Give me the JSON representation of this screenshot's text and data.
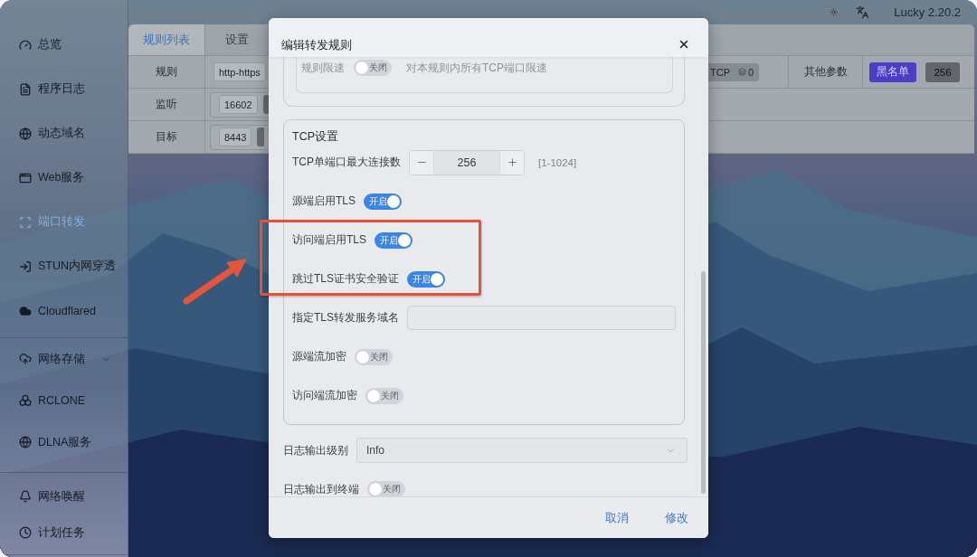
{
  "top_bar": {
    "version": "Lucky 2.20.2"
  },
  "sidebar": {
    "groups": [
      {
        "items": [
          {
            "kind": "link",
            "label": "总览",
            "selected": false
          },
          {
            "kind": "link",
            "label": "程序日志",
            "selected": false
          },
          {
            "kind": "link",
            "label": "动态域名",
            "selected": false
          },
          {
            "kind": "link",
            "label": "Web服务",
            "selected": false
          },
          {
            "kind": "link",
            "label": "端口转发",
            "selected": true
          },
          {
            "kind": "link",
            "label": "STUN内网穿透",
            "selected": false
          },
          {
            "kind": "link",
            "label": "Cloudflared",
            "selected": false
          }
        ]
      },
      {
        "items": [
          {
            "kind": "group",
            "label": "网络存储",
            "selected": false,
            "expanded": false
          },
          {
            "kind": "link",
            "label": "RCLONE",
            "selected": false
          },
          {
            "kind": "link",
            "label": "DLNA服务",
            "selected": false
          }
        ]
      },
      {
        "items": [
          {
            "kind": "link",
            "label": "网络唤醒",
            "selected": false
          },
          {
            "kind": "link",
            "label": "计划任务",
            "selected": false
          }
        ]
      }
    ]
  },
  "rule_card": {
    "tabs": [
      {
        "label": "规则列表",
        "selected": true
      },
      {
        "label": "设置",
        "selected": false
      }
    ],
    "rows": [
      {
        "kind": "rule",
        "label": "规则",
        "values": [
          {
            "kind": "chip",
            "text": "http-https"
          }
        ],
        "protocol": "TCP",
        "connections": "0",
        "params_label": "其他参数",
        "blacklist_button": "黑名单",
        "limit": "256"
      },
      {
        "kind": "ports",
        "label": "监听",
        "values": [
          {
            "kind": "chip",
            "text": "16602"
          },
          {
            "kind": "tag"
          }
        ]
      },
      {
        "kind": "ports",
        "label": "目标",
        "values": [
          {
            "kind": "chip",
            "text": "8443"
          },
          {
            "kind": "tag"
          }
        ]
      }
    ]
  },
  "dialog": {
    "title": "编辑转发规则",
    "speed_limit": {
      "label": "规则限速",
      "on": false,
      "state_text": "关闭",
      "description": "对本规则内所有TCP端口限速"
    },
    "tcp_settings": {
      "title": "TCP设置",
      "rows": [
        {
          "kind": "stepper",
          "label": "TCP单端口最大连接数",
          "value": "256",
          "range": "[1-1024]"
        },
        {
          "kind": "switch",
          "label": "源端启用TLS",
          "on": true,
          "state_text": "开启"
        },
        {
          "kind": "switch",
          "label": "访问端启用TLS",
          "on": true,
          "state_text": "开启"
        },
        {
          "kind": "switch",
          "label": "跳过TLS证书安全验证",
          "on": true,
          "state_text": "开启"
        },
        {
          "kind": "input",
          "label": "指定TLS转发服务域名"
        },
        {
          "kind": "switch",
          "label": "源端流加密",
          "on": false,
          "state_text": "关闭"
        },
        {
          "kind": "switch",
          "label": "访问端流加密",
          "on": false,
          "state_text": "关闭"
        }
      ]
    },
    "log_level": {
      "label": "日志输出级别",
      "value": "Info"
    },
    "log_to_terminal": {
      "label": "日志输出到终端",
      "on": false,
      "state_text": "关闭"
    },
    "buttons": [
      {
        "label": "取消"
      },
      {
        "label": "修改"
      }
    ]
  }
}
